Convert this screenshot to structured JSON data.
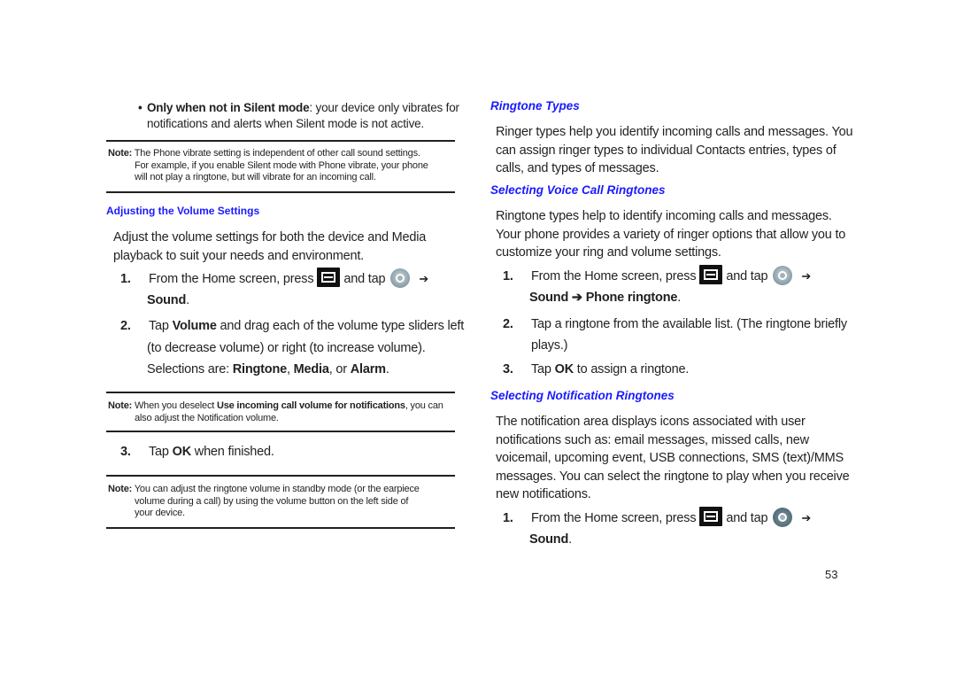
{
  "left": {
    "bullet": {
      "bold": "Only when not in Silent mode",
      "rest_line1": ": your device only vibrates for",
      "rest_line2": "notifications and alerts when Silent mode is not active."
    },
    "note1": {
      "label": "Note:",
      "line1": "The Phone vibrate setting is independent of other call sound settings.",
      "line2": "For example, if you enable Silent mode with Phone vibrate, your phone",
      "line3": "will not play a ringtone, but will vibrate for an incoming call."
    },
    "heading": "Adjusting the Volume Settings",
    "intro_line1": "Adjust the volume settings for both the device and Media",
    "intro_line2": "playback to suit your needs and environment.",
    "step1": {
      "num": "1.",
      "text_a": "From the Home screen, press",
      "text_b": "and tap",
      "arrow": "➔",
      "target": "Sound",
      "end": "."
    },
    "step2": {
      "num": "2.",
      "a": "Tap ",
      "b_bold": "Volume",
      "c": " and drag each of the volume type sliders left",
      "line2": "(to decrease volume) or right (to increase volume).",
      "line3_a": "Selections are: ",
      "ringtone": "Ringtone",
      "comma": ", ",
      "media": "Media",
      "or": ", or ",
      "alarm": "Alarm",
      "end": "."
    },
    "note2": {
      "label": "Note:",
      "a": "When you deselect ",
      "b_bold": "Use incoming call volume for notifications",
      "c": ", you can",
      "line2": "also adjust the Notification volume."
    },
    "step3": {
      "num": "3.",
      "a": "Tap ",
      "b_bold": "OK",
      "c": " when finished."
    },
    "note3": {
      "label": "Note:",
      "line1": "You can adjust the ringtone volume in standby mode (or the earpiece",
      "line2": "volume during a call) by using the volume button on the left side of",
      "line3": "your device."
    }
  },
  "right": {
    "heading1": "Ringtone Types",
    "para1_line1": "Ringer types help you identify incoming calls and messages. You",
    "para1_line2": "can assign ringer types to individual Contacts entries, types of",
    "para1_line3": "calls, and types of messages.",
    "heading2": "Selecting Voice Call Ringtones",
    "para2_line1": "Ringtone types help to identify incoming calls and messages.",
    "para2_line2": "Your phone provides a variety of ringer options that allow you to",
    "para2_line3": "customize your ring and volume settings.",
    "v_step1": {
      "num": "1.",
      "text_a": "From the Home screen, press",
      "text_b": "and tap",
      "arrow": "➔",
      "target": "Sound ➔ Phone ringtone",
      "end": "."
    },
    "v_step2": {
      "num": "2.",
      "line1": "Tap a ringtone from the available list. (The ringtone briefly",
      "line2": "plays.)"
    },
    "v_step3": {
      "num": "3.",
      "a": "Tap ",
      "b_bold": "OK",
      "c": " to assign a ringtone."
    },
    "heading3": "Selecting Notification Ringtones",
    "para3_line1": "The notification area displays icons associated with user",
    "para3_line2": "notifications such as: email messages, missed calls, new",
    "para3_line3": "voicemail, upcoming event, USB connections, SMS (text)/MMS",
    "para3_line4": "messages. You can select the ringtone to play when you receive",
    "para3_line5": "new notifications.",
    "n_step1": {
      "num": "1.",
      "text_a": "From the Home screen, press",
      "text_b": "and tap",
      "arrow": "➔",
      "target": "Sound",
      "end": "."
    }
  },
  "page_number": "53",
  "colors": {
    "heading_blue": "#1a1aff",
    "text": "#231f20"
  }
}
